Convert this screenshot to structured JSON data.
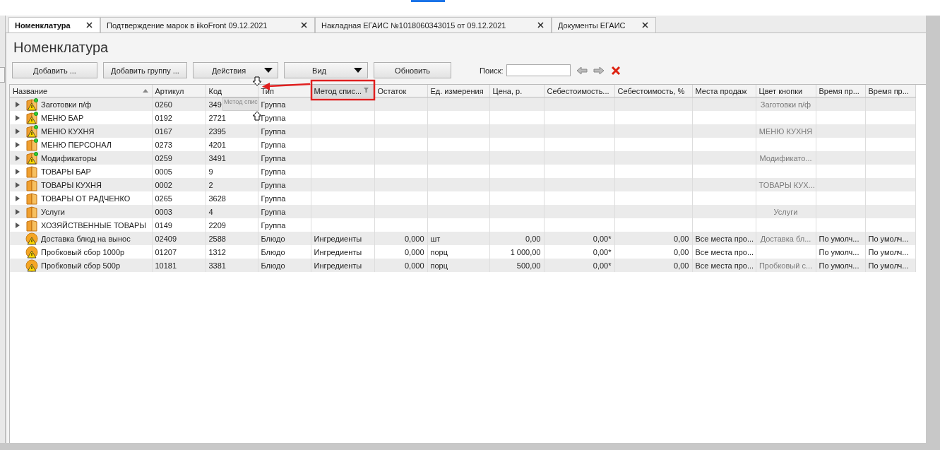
{
  "tabs": [
    {
      "label": "Номенклатура",
      "selected": true
    },
    {
      "label": "Подтверждение марок в iikoFront 09.12.2021",
      "selected": false
    },
    {
      "label": "Накладная ЕГАИС №1018060343015 от 09.12.2021",
      "selected": false
    },
    {
      "label": "Документы ЕГАИС",
      "selected": false
    }
  ],
  "page_title": "Номенклатура",
  "toolbar": {
    "buttons": [
      {
        "label": "Добавить ...",
        "kind": "plain"
      },
      {
        "label": "Добавить группу ...",
        "kind": "plain"
      },
      {
        "label": "Действия",
        "kind": "dropdown"
      },
      {
        "label": "Вид",
        "kind": "dropdown"
      },
      {
        "label": "Обновить",
        "kind": "plain"
      }
    ],
    "search": {
      "label": "Поиск:"
    }
  },
  "table": {
    "columns": [
      {
        "label": "Название",
        "kind": "text",
        "sorted": true,
        "filtered": false,
        "selected": false
      },
      {
        "label": "Артикул",
        "kind": "text",
        "sorted": false,
        "filtered": false,
        "selected": false
      },
      {
        "label": "Код",
        "kind": "text",
        "sorted": false,
        "filtered": false,
        "selected": false
      },
      {
        "label": "Тип",
        "kind": "text",
        "sorted": false,
        "filtered": false,
        "selected": false
      },
      {
        "label": "Метод спис...",
        "kind": "text",
        "sorted": false,
        "filtered": true,
        "selected": true
      },
      {
        "label": "Остаток",
        "kind": "number",
        "sorted": false,
        "filtered": false,
        "selected": false
      },
      {
        "label": "Ед. измерения",
        "kind": "text",
        "sorted": false,
        "filtered": false,
        "selected": false
      },
      {
        "label": "Цена, р.",
        "kind": "number",
        "sorted": false,
        "filtered": false,
        "selected": false
      },
      {
        "label": "Себестоимость...",
        "kind": "number",
        "sorted": false,
        "filtered": false,
        "selected": false
      },
      {
        "label": "Себестоимость, %",
        "kind": "number",
        "sorted": false,
        "filtered": false,
        "selected": false
      },
      {
        "label": "Места продаж",
        "kind": "text",
        "sorted": false,
        "filtered": false,
        "selected": false
      },
      {
        "label": "Цвет кнопки",
        "kind": "swatch",
        "sorted": false,
        "filtered": false,
        "selected": false
      },
      {
        "label": "Время пр...",
        "kind": "text",
        "sorted": false,
        "filtered": false,
        "selected": false
      },
      {
        "label": "Время пр...",
        "kind": "text",
        "sorted": false,
        "filtered": false,
        "selected": false
      }
    ],
    "rows": [
      {
        "kind": "group",
        "warning": true,
        "in_menu": true,
        "cells": [
          "Заготовки п/ф",
          "0260",
          "349",
          "Группа",
          null,
          null,
          null,
          null,
          null,
          null,
          null,
          "Заготовки п/ф",
          null,
          null
        ]
      },
      {
        "kind": "group",
        "warning": true,
        "in_menu": true,
        "cells": [
          "МЕНЮ БАР",
          "0192",
          "2721",
          "Группа",
          null,
          null,
          null,
          null,
          null,
          null,
          null,
          null,
          null,
          null
        ]
      },
      {
        "kind": "group",
        "warning": true,
        "in_menu": true,
        "cells": [
          "МЕНЮ КУХНЯ",
          "0167",
          "2395",
          "Группа",
          null,
          null,
          null,
          null,
          null,
          null,
          null,
          "МЕНЮ КУХНЯ",
          null,
          null
        ]
      },
      {
        "kind": "group",
        "warning": false,
        "in_menu": true,
        "cells": [
          "МЕНЮ ПЕРСОНАЛ",
          "0273",
          "4201",
          "Группа",
          null,
          null,
          null,
          null,
          null,
          null,
          null,
          null,
          null,
          null
        ]
      },
      {
        "kind": "group",
        "warning": true,
        "in_menu": true,
        "cells": [
          "Модификаторы",
          "0259",
          "3491",
          "Группа",
          null,
          null,
          null,
          null,
          null,
          null,
          null,
          "Модификато...",
          null,
          null
        ]
      },
      {
        "kind": "group",
        "warning": false,
        "in_menu": false,
        "cells": [
          "ТОВАРЫ БАР",
          "0005",
          "9",
          "Группа",
          null,
          null,
          null,
          null,
          null,
          null,
          null,
          null,
          null,
          null
        ]
      },
      {
        "kind": "group",
        "warning": false,
        "in_menu": false,
        "cells": [
          "ТОВАРЫ КУХНЯ",
          "0002",
          "2",
          "Группа",
          null,
          null,
          null,
          null,
          null,
          null,
          null,
          "ТОВАРЫ КУХ...",
          null,
          null
        ]
      },
      {
        "kind": "group",
        "warning": false,
        "in_menu": false,
        "cells": [
          "ТОВАРЫ ОТ РАДЧЕНКО",
          "0265",
          "3628",
          "Группа",
          null,
          null,
          null,
          null,
          null,
          null,
          null,
          null,
          null,
          null
        ]
      },
      {
        "kind": "group",
        "warning": false,
        "in_menu": false,
        "cells": [
          "Услуги",
          "0003",
          "4",
          "Группа",
          null,
          null,
          null,
          null,
          null,
          null,
          null,
          "Услуги",
          null,
          null
        ]
      },
      {
        "kind": "group",
        "warning": false,
        "in_menu": false,
        "cells": [
          "ХОЗЯЙСТВЕННЫЕ ТОВАРЫ",
          "0149",
          "2209",
          "Группа",
          null,
          null,
          null,
          null,
          null,
          null,
          null,
          null,
          null,
          null
        ]
      },
      {
        "kind": "dish",
        "warning": true,
        "in_menu": false,
        "cells": [
          "Доставка блюд на вынос",
          "02409",
          "2588",
          "Блюдо",
          "Ингредиенты",
          "0,000",
          "шт",
          "0,00",
          "0,00*",
          "0,00",
          "Все места про...",
          "Доставка бл...",
          "По умолч...",
          "По умолч..."
        ]
      },
      {
        "kind": "dish",
        "warning": true,
        "in_menu": false,
        "cells": [
          "Пробковый сбор 1000р",
          "01207",
          "1312",
          "Блюдо",
          "Ингредиенты",
          "0,000",
          "порц",
          "1 000,00",
          "0,00*",
          "0,00",
          "Все места про...",
          null,
          "По умолч...",
          "По умолч..."
        ]
      },
      {
        "kind": "dish",
        "warning": true,
        "in_menu": false,
        "cells": [
          "Пробковый сбор 500р",
          "10181",
          "3381",
          "Блюдо",
          "Ингредиенты",
          "0,000",
          "порц",
          "500,00",
          "0,00*",
          "0,00",
          "Все места про...",
          "Пробковый с...",
          "По умолч...",
          "По умолч..."
        ]
      }
    ]
  },
  "drag_ghost": {
    "label": "Метод спис"
  }
}
